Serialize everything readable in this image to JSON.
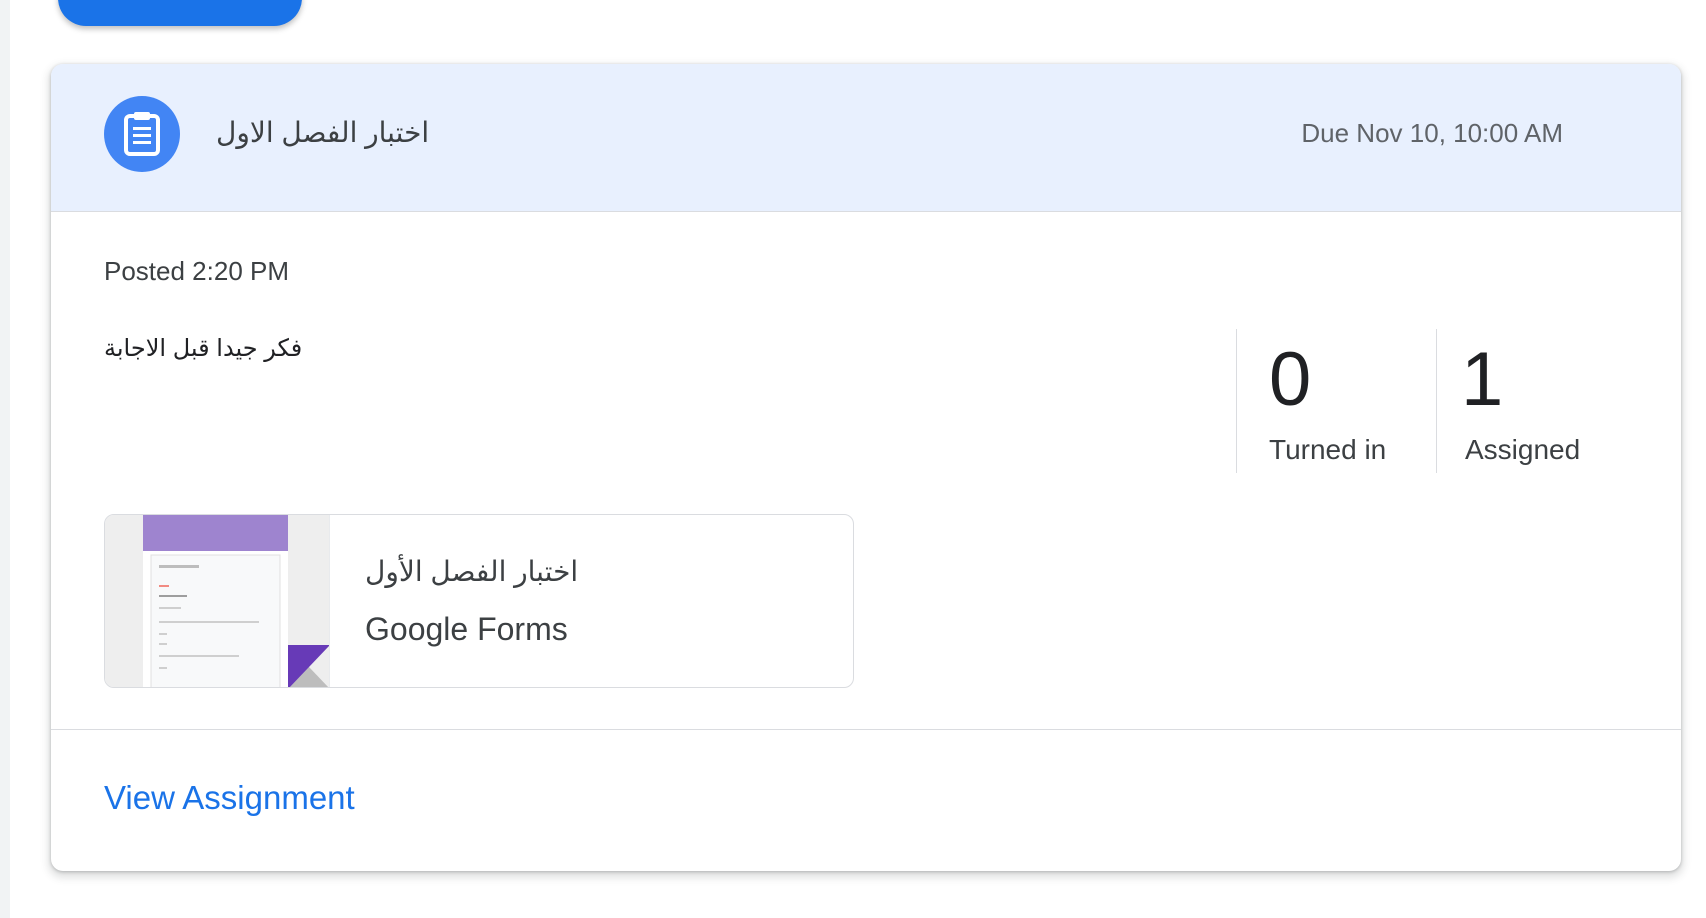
{
  "assignment": {
    "title": "اختبار الفصل الاول",
    "due": "Due Nov 10, 10:00 AM",
    "posted": "Posted 2:20 PM",
    "instructions": "فكر جيدا قبل الاجابة",
    "icon": "assignment-icon"
  },
  "stats": [
    {
      "value": "0",
      "label": "Turned in"
    },
    {
      "value": "1",
      "label": "Assigned"
    }
  ],
  "attachment": {
    "title": "اختبار الفصل الأول",
    "type": "Google Forms",
    "thumbnail_icon": "google-forms-thumbnail"
  },
  "footer": {
    "view_link": "View Assignment"
  },
  "colors": {
    "accent": "#1a73e8",
    "header_bg": "#e8f0fe",
    "icon_bg": "#4285f4",
    "forms_purple": "#9e84cf",
    "forms_corner": "#673ab7"
  }
}
